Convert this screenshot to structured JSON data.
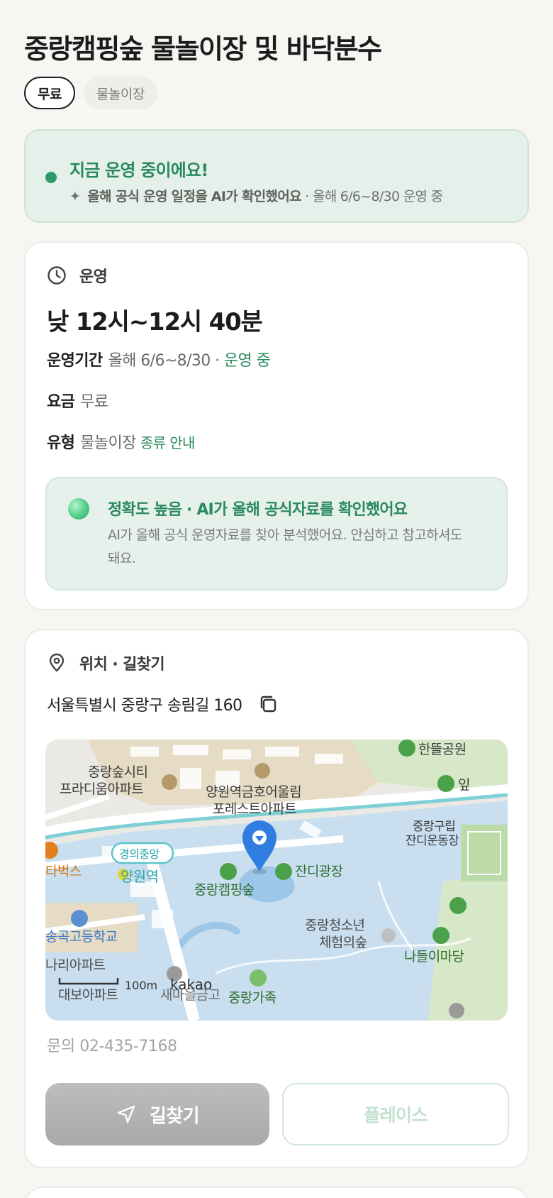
{
  "header": {
    "title": "중랑캠핑숲 물놀이장 및 바닥분수",
    "tags": [
      "무료",
      "물놀이장"
    ]
  },
  "status_banner": {
    "title": "지금 운영 중이에요!",
    "sub_strong": "올해 공식 운영 일정을 AI가 확인했어요",
    "sub_rest": " · 올해 6/6~8/30 운영 중"
  },
  "operation": {
    "section_title": "운영",
    "hours": "낮 12시~12시 40분",
    "period_label": "운영기간",
    "period_value": "올해 6/6~8/30",
    "period_status": " · 운영 중",
    "fee_label": "요금",
    "fee_value": "무료",
    "type_label": "유형",
    "type_value": "물놀이장",
    "type_link": "종류 안내",
    "accuracy_title": "정확도 높음 · AI가 올해 공식자료를 확인했어요",
    "accuracy_desc": "AI가 올해 공식 운영자료를 찾아 분석했어요. 안심하고 참고하셔도 돼요."
  },
  "location": {
    "section_title": "위치 · 길찾기",
    "address": "서울특별시 중랑구 송림길 160",
    "contact": "문의 02-435-7168",
    "nav_button": "길찾기",
    "place_button": "플레이스"
  },
  "map": {
    "labels": {
      "apt1a": "중랑숲시티",
      "apt1b": "프라디움아파트",
      "apt2a": "양원역금호어울림",
      "apt2b": "포레스트아파트",
      "park_top": "한뜰공원",
      "park_top2": "잎",
      "field_a": "중랑구립",
      "field_b": "잔디운동장",
      "station_line": "경의중앙",
      "station": "양원역",
      "cafe": "타벅스",
      "camp": "중랑캠핑숲",
      "lawn": "잔디광장",
      "youth_a": "중랑청소년",
      "youth_b": "체험의숲",
      "school": "송곡고등학교",
      "apt3": "나리아파트",
      "apt4": "대보아파트",
      "market": "새마을금고",
      "family": "중랑가족",
      "nadeuli": "나들이마당",
      "scale": "100m",
      "brand": "kakao"
    },
    "colors": {
      "water": "#c9dfef",
      "park": "#d7e8c8",
      "road": "#ffffff",
      "rail": "#7ecfd6",
      "pin": "#2f7de1"
    }
  }
}
